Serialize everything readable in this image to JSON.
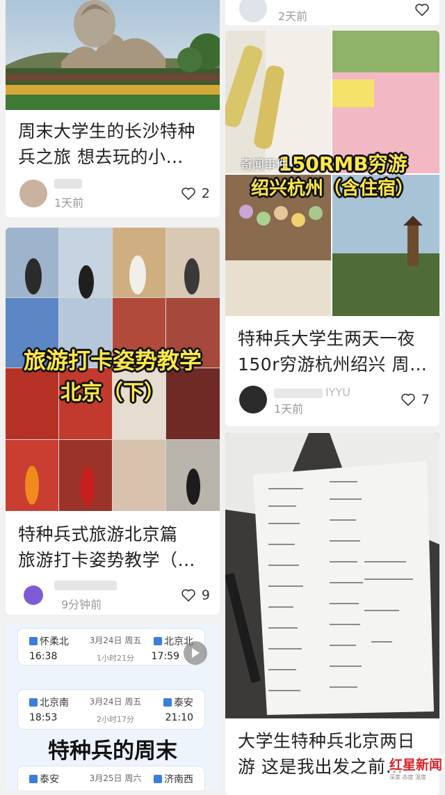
{
  "feed": {
    "left": [
      {
        "title_lines": [
          "周末大学生的长沙特种",
          "兵之旅 想去玩的小…"
        ],
        "time": "1天前",
        "likes": "2"
      },
      {
        "overlay_line1": "旅游打卡姿势教学",
        "overlay_line2": "北京（下）",
        "title_lines": [
          "特种兵式旅游北京篇",
          "旅游打卡姿势教学（…"
        ],
        "time": "9分钟前",
        "likes": "9"
      },
      {
        "overlay_title": "特种兵的周末",
        "tickets": [
          {
            "from": "怀柔北",
            "to": "北京北",
            "date": "3月24日 周五",
            "dep": "16:38",
            "arr": "17:59",
            "duration": "1小时21分"
          },
          {
            "from": "北京南",
            "to": "泰安",
            "date": "3月24日 周五",
            "dep": "18:53",
            "arr": "21:10",
            "duration": "2小时17分"
          },
          {
            "from": "泰安",
            "to": "济南西",
            "date": "3月25日 周六"
          }
        ]
      }
    ],
    "right": [
      {
        "time": "2天前"
      },
      {
        "overlay_line1": "150RMB穷游",
        "overlay_line2": "绍兴杭州（含住宿）",
        "watermark": "奇闻事件",
        "title_lines": [
          "特种兵大学生两天一夜",
          "150r穷游杭州绍兴 周…"
        ],
        "username_tail": "IYYU",
        "time": "1天前",
        "likes": "7"
      },
      {
        "title_lines": [
          "大学生特种兵北京两日",
          "游 这是我出发之前…"
        ]
      }
    ]
  },
  "brand_watermark": {
    "main": "红星新闻",
    "sub": "深度 态度 温度"
  },
  "colors": {
    "heart": "#333333",
    "ticket_blue": "#3b7ddd",
    "overlay_yellow": "#ffe84a"
  }
}
